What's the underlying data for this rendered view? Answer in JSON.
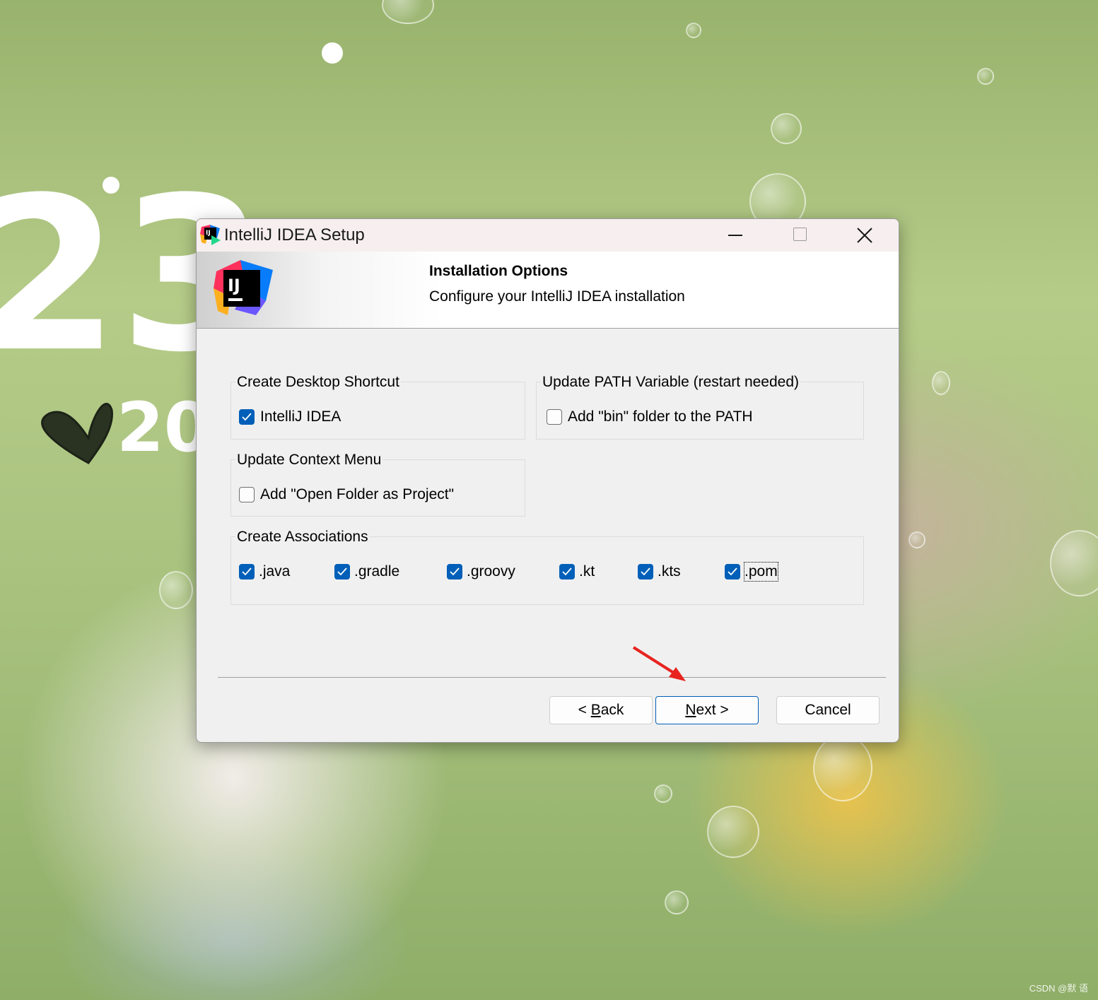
{
  "window": {
    "title": "IntelliJ IDEA Setup",
    "controls": [
      "minimize",
      "maximize",
      "close"
    ]
  },
  "header": {
    "title": "Installation Options",
    "subtitle": "Configure your IntelliJ IDEA installation",
    "logo_text": "IJ"
  },
  "groups": {
    "desktop_shortcut": {
      "label": "Create Desktop Shortcut",
      "options": [
        {
          "label": "IntelliJ IDEA",
          "checked": true
        }
      ]
    },
    "path_variable": {
      "label": "Update PATH Variable (restart needed)",
      "options": [
        {
          "label": "Add \"bin\" folder to the PATH",
          "checked": false
        }
      ]
    },
    "context_menu": {
      "label": "Update Context Menu",
      "options": [
        {
          "label": "Add \"Open Folder as Project\"",
          "checked": false
        }
      ]
    },
    "associations": {
      "label": "Create Associations",
      "options": [
        {
          "label": ".java",
          "checked": true
        },
        {
          "label": ".gradle",
          "checked": true
        },
        {
          "label": ".groovy",
          "checked": true
        },
        {
          "label": ".kt",
          "checked": true
        },
        {
          "label": ".kts",
          "checked": true
        },
        {
          "label": ".pom",
          "checked": true
        }
      ]
    }
  },
  "buttons": {
    "back_prefix": "< ",
    "back_mnemonic": "B",
    "back_rest": "ack",
    "next_mnemonic": "N",
    "next_rest": "ext >",
    "cancel": "Cancel"
  },
  "wallpaper": {
    "number_big": "23",
    "number_small": "20",
    "watermark": "CSDN @默 语"
  },
  "colors": {
    "accent": "#005fb8",
    "dialog_bg": "#f0f0f0",
    "titlebar_bg": "#f7efef",
    "annotation_arrow": "#e8231f"
  }
}
